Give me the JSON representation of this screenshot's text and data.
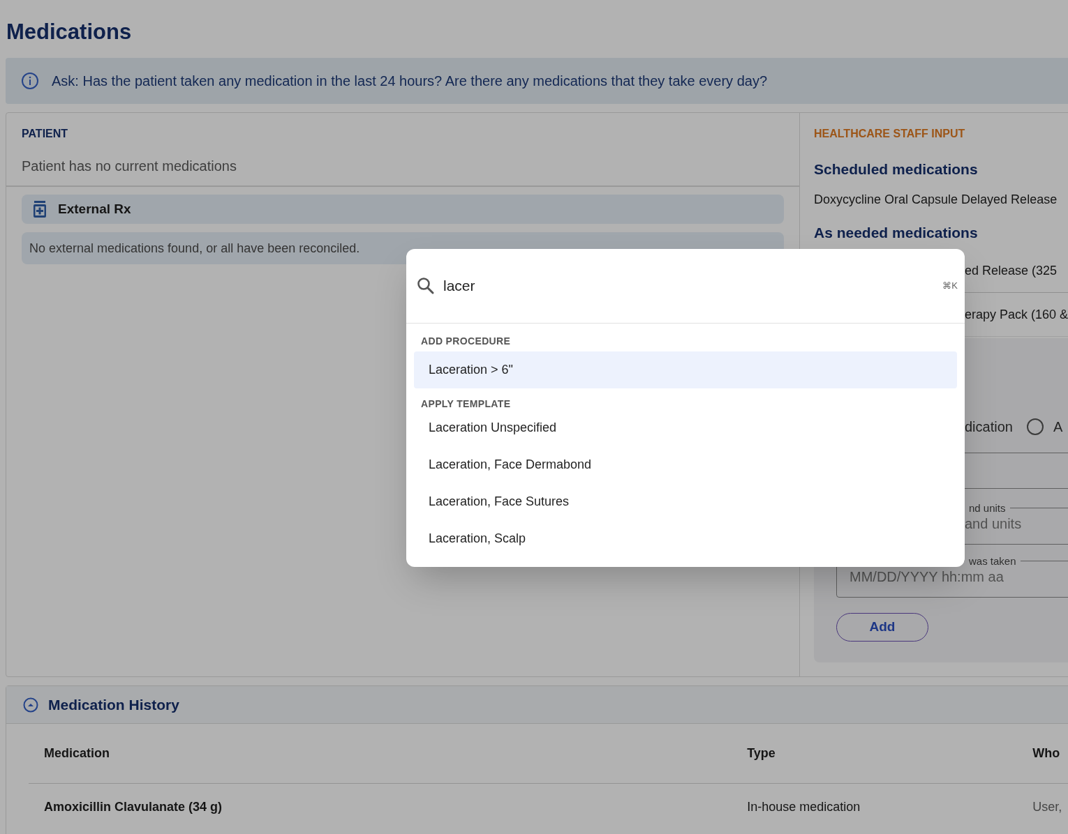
{
  "page_title": "Medications",
  "prompt_banner": {
    "text": "Ask: Has the patient taken any medication in the last 24 hours? Are there any medications that they take every day?"
  },
  "patient": {
    "heading": "PATIENT",
    "status": "Patient has no current medications",
    "external_rx": {
      "title": "External Rx",
      "message": "No external medications found, or all have been reconciled."
    }
  },
  "staff_input": {
    "heading": "HEALTHCARE STAFF INPUT",
    "scheduled": {
      "title": "Scheduled medications",
      "items": [
        "Doxycycline Oral Capsule Delayed Release"
      ]
    },
    "as_needed": {
      "title": "As needed medications",
      "items": [
        "ed Release (325",
        "erapy Pack (160 &"
      ]
    },
    "form": {
      "radio_option_partial": "dication",
      "radio_options": [
        {
          "label": "A",
          "selected": false
        }
      ],
      "fields": [
        {
          "label": "nd units",
          "placeholder": "and units"
        },
        {
          "label": "was taken",
          "placeholder": "MM/DD/YYYY hh:mm aa"
        }
      ],
      "button": "Add"
    }
  },
  "search_modal": {
    "query": "lacer",
    "shortcut": "⌘K",
    "groups": [
      {
        "heading": "ADD PROCEDURE",
        "items": [
          {
            "label": "Laceration > 6\"",
            "selected": true
          }
        ]
      },
      {
        "heading": "APPLY TEMPLATE",
        "items": [
          {
            "label": "Laceration Unspecified",
            "selected": false
          },
          {
            "label": "Laceration, Face Dermabond",
            "selected": false
          },
          {
            "label": "Laceration, Face Sutures",
            "selected": false
          },
          {
            "label": "Laceration, Scalp",
            "selected": false
          }
        ]
      }
    ]
  },
  "history": {
    "title": "Medication History",
    "expanded": true,
    "columns": [
      "Medication",
      "Type",
      "Who"
    ],
    "rows": [
      [
        "Amoxicillin Clavulanate (34 g)",
        "In-house medication",
        "User,"
      ]
    ]
  }
}
